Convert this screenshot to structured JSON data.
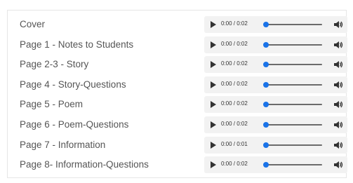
{
  "audio_list": {
    "items": [
      {
        "label": "Cover",
        "time": "0:00 / 0:02",
        "progress": 0
      },
      {
        "label": "Page 1 - Notes to Students",
        "time": "0:00 / 0:02",
        "progress": 0
      },
      {
        "label": "Page 2-3 - Story",
        "time": "0:00 / 0:02",
        "progress": 0
      },
      {
        "label": "Page 4 - Story-Questions",
        "time": "0:00 / 0:02",
        "progress": 0
      },
      {
        "label": "Page 5 - Poem",
        "time": "0:00 / 0:02",
        "progress": 0
      },
      {
        "label": "Page 6 - Poem-Questions",
        "time": "0:00 / 0:02",
        "progress": 0
      },
      {
        "label": "Page 7 - Information",
        "time": "0:00 / 0:01",
        "progress": 0
      },
      {
        "label": "Page 8- Information-Questions",
        "time": "0:00 / 0:02",
        "progress": 0
      }
    ],
    "icons": {
      "play": "play-icon",
      "volume": "volume-icon"
    },
    "colors": {
      "accent": "#1a73e8",
      "player_background": "#f2f2f2",
      "label_text": "#555555"
    }
  }
}
